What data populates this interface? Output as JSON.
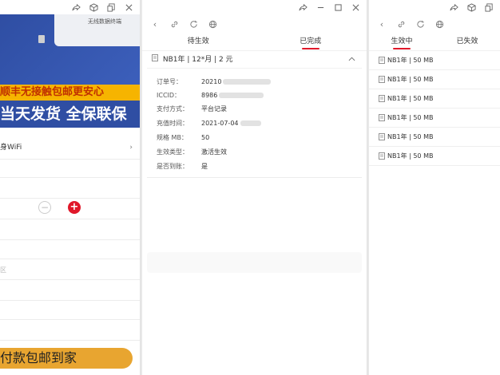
{
  "left_window": {
    "banner_device_label": "无线数据终端",
    "banner_line1": "顺丰无接触包邮更安心",
    "banner_line2": "当天发货 全保联保",
    "wifi_option_label": "身WiFi",
    "qty_minus": "−",
    "qty_plus": "+",
    "hint_char": "区",
    "pay_button_label": "付款包邮到家"
  },
  "middle_window": {
    "tabs": [
      {
        "label": "待生效",
        "active": false
      },
      {
        "label": "已完成",
        "active": true
      }
    ],
    "order_header": "NB1年 | 12*月 | 2 元",
    "details": [
      {
        "label": "订单号：",
        "value": "20210"
      },
      {
        "label": "ICCID：",
        "value": "8986"
      },
      {
        "label": "支付方式：",
        "value": "平台记录"
      },
      {
        "label": "充值时间：",
        "value": "2021-07-04"
      },
      {
        "label": "规格 MB：",
        "value": "50"
      },
      {
        "label": "生效类型：",
        "value": "激活生效"
      },
      {
        "label": "是否到账：",
        "value": "是"
      }
    ]
  },
  "right_window": {
    "tabs": [
      {
        "label": "生效中",
        "active": true
      },
      {
        "label": "已失效",
        "active": false
      }
    ],
    "items": [
      "NB1年 | 50 MB",
      "NB1年 | 50 MB",
      "NB1年 | 50 MB",
      "NB1年 | 50 MB",
      "NB1年 | 50 MB",
      "NB1年 | 50 MB"
    ]
  },
  "colors": {
    "accent_red": "#e0182a",
    "banner_blue": "#2f4ea3",
    "banner_orange": "#f6b400",
    "pay_orange": "#e8a530"
  },
  "icons": [
    "back-icon",
    "link-icon",
    "refresh-icon",
    "globe-icon",
    "share-icon",
    "cube-icon",
    "window-icon",
    "minimize-icon",
    "maximize-icon",
    "close-icon",
    "document-icon",
    "chevron-right-icon",
    "chevron-up-icon"
  ]
}
